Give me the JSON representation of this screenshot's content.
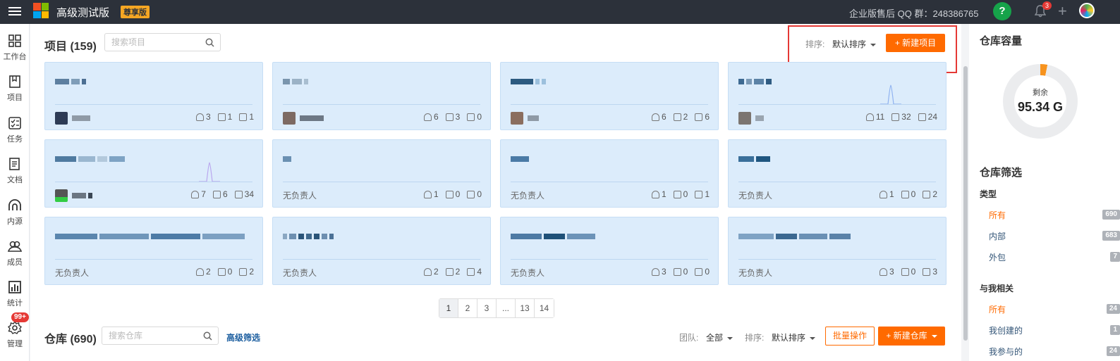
{
  "topbar": {
    "app_title": "高级测试版",
    "vip_badge": "尊享版",
    "support_qq": "企业版售后 QQ 群：248386765",
    "help": "?",
    "notification_count": "3"
  },
  "nav": {
    "items": [
      "工作台",
      "项目",
      "任务",
      "文档",
      "内源",
      "成员",
      "统计",
      "管理"
    ],
    "admin_badge": "99+"
  },
  "projects": {
    "title": "项目 (159)",
    "search_placeholder": "搜索项目",
    "sort_label": "排序:",
    "sort_value": "默认排序",
    "new_button": "+ 新建项目",
    "no_owner": "无负责人",
    "cards": [
      {
        "members": "3",
        "repos": "1",
        "tasks": "1",
        "owner": ""
      },
      {
        "members": "6",
        "repos": "3",
        "tasks": "0",
        "owner": ""
      },
      {
        "members": "6",
        "repos": "2",
        "tasks": "6",
        "owner": ""
      },
      {
        "members": "11",
        "repos": "32",
        "tasks": "24",
        "owner": ""
      },
      {
        "members": "7",
        "repos": "6",
        "tasks": "34",
        "owner": ""
      },
      {
        "members": "1",
        "repos": "0",
        "tasks": "0",
        "owner": "无负责人"
      },
      {
        "members": "1",
        "repos": "0",
        "tasks": "1",
        "owner": "无负责人"
      },
      {
        "members": "1",
        "repos": "0",
        "tasks": "2",
        "owner": "无负责人"
      },
      {
        "members": "2",
        "repos": "0",
        "tasks": "2",
        "owner": "无负责人"
      },
      {
        "members": "2",
        "repos": "2",
        "tasks": "4",
        "owner": "无负责人"
      },
      {
        "members": "3",
        "repos": "0",
        "tasks": "0",
        "owner": "无负责人"
      },
      {
        "members": "3",
        "repos": "0",
        "tasks": "3",
        "owner": "无负责人"
      }
    ],
    "pagination": [
      "1",
      "2",
      "3",
      "...",
      "13",
      "14"
    ]
  },
  "repos": {
    "title": "仓库 (690)",
    "search_placeholder": "搜索仓库",
    "advanced_filter": "高级筛选",
    "team_label": "团队:",
    "team_value": "全部",
    "sort_label": "排序:",
    "sort_value": "默认排序",
    "batch_button": "批量操作",
    "new_button": "+ 新建仓库"
  },
  "right_panel": {
    "capacity_title": "仓库容量",
    "remaining_label": "剩余",
    "remaining_value": "95.34 G",
    "used_fraction": 0.03,
    "filter_title": "仓库筛选",
    "type_label": "类型",
    "type_rows": [
      {
        "label": "所有",
        "count": "690"
      },
      {
        "label": "内部",
        "count": "683"
      },
      {
        "label": "外包",
        "count": "7"
      }
    ],
    "related_label": "与我相关",
    "related_rows": [
      {
        "label": "所有",
        "count": "24"
      },
      {
        "label": "我创建的",
        "count": "1"
      },
      {
        "label": "我参与的",
        "count": "24"
      }
    ]
  },
  "colors": {
    "accent": "#ff6a00",
    "topbar": "#2c313a",
    "card_bg": "#dcecfb"
  }
}
